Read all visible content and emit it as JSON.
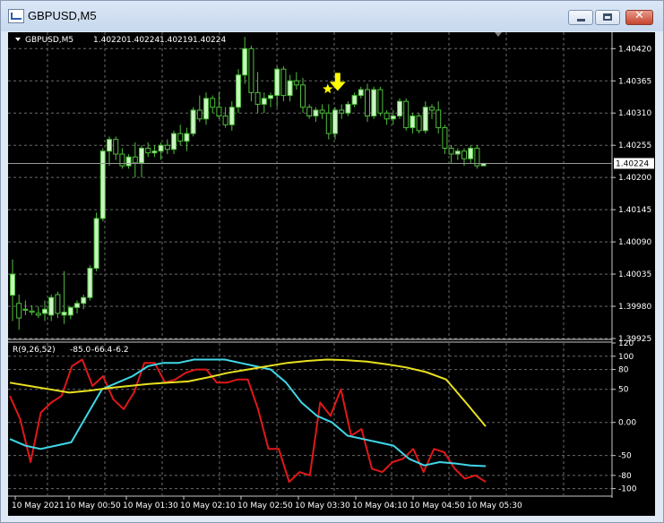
{
  "window": {
    "title": "GBPUSD,M5",
    "close_glyph": "✕",
    "icons": {
      "app": "chart-window-icon",
      "minimize": "minimize-icon",
      "maximize": "maximize-icon",
      "close": "close-icon",
      "triangle": "collapse-triangle-icon",
      "arrow": "down-arrow-icon",
      "star": "star-icon",
      "scroll_marker": "chart-shift-marker-icon"
    }
  },
  "colors": {
    "background": "#000000",
    "grid": "#6b6b6b",
    "text": "#ffffff",
    "bull_candle": "#c8f5c0",
    "bear_candle": "#000000",
    "wick": "#4fbf3c",
    "cyan_line": "#3fd7e8",
    "red_line": "#e01818",
    "yellow_line": "#e8e020",
    "marker": "#ffff00"
  },
  "price_header": {
    "symbol": "GBPUSD,M5",
    "open": "1.40220",
    "high": "1.40224",
    "low": "1.40219",
    "close": "1.40224"
  },
  "indicator_header": {
    "label": "R(9,26,52)",
    "v1": "-85.0",
    "v2": "-66.4",
    "v3": "-6.2"
  },
  "current_price": "1.40224",
  "price_axis": [
    "1.40420",
    "1.40365",
    "1.40310",
    "1.40255",
    "1.40200",
    "1.40145",
    "1.40090",
    "1.40035",
    "1.39980",
    "1.39925"
  ],
  "indicator_axis": [
    "120",
    "100",
    "80",
    "50",
    "0.00",
    "-50",
    "-80",
    "-100"
  ],
  "time_axis": [
    "10 May 2021",
    "10 May 00:50",
    "10 May 01:30",
    "10 May 02:10",
    "10 May 02:50",
    "10 May 03:30",
    "10 May 04:10",
    "10 May 04:50",
    "10 May 05:30"
  ],
  "chart_data": {
    "type": "candlestick",
    "symbol": "GBPUSD",
    "timeframe": "M5",
    "price_range": [
      1.39925,
      1.40448
    ],
    "candles": [
      {
        "o": 1.39999,
        "h": 1.4006,
        "l": 1.39955,
        "c": 1.40035
      },
      {
        "o": 1.39985,
        "h": 1.4,
        "l": 1.3994,
        "c": 1.3996
      },
      {
        "o": 1.39975,
        "h": 1.3999,
        "l": 1.39965,
        "c": 1.39975
      },
      {
        "o": 1.39972,
        "h": 1.39982,
        "l": 1.39965,
        "c": 1.3997
      },
      {
        "o": 1.39968,
        "h": 1.3998,
        "l": 1.3996,
        "c": 1.39965
      },
      {
        "o": 1.39968,
        "h": 1.3999,
        "l": 1.39955,
        "c": 1.39975
      },
      {
        "o": 1.39965,
        "h": 1.4,
        "l": 1.39955,
        "c": 1.39995
      },
      {
        "o": 1.4,
        "h": 1.40005,
        "l": 1.3996,
        "c": 1.39968
      },
      {
        "o": 1.39965,
        "h": 1.4004,
        "l": 1.3995,
        "c": 1.3997
      },
      {
        "o": 1.39965,
        "h": 1.3998,
        "l": 1.39958,
        "c": 1.39978
      },
      {
        "o": 1.39978,
        "h": 1.3999,
        "l": 1.39968,
        "c": 1.39985
      },
      {
        "o": 1.39985,
        "h": 1.4,
        "l": 1.39975,
        "c": 1.39995
      },
      {
        "o": 1.39995,
        "h": 1.4005,
        "l": 1.3999,
        "c": 1.40045
      },
      {
        "o": 1.40045,
        "h": 1.4014,
        "l": 1.4004,
        "c": 1.4013
      },
      {
        "o": 1.4013,
        "h": 1.4025,
        "l": 1.40125,
        "c": 1.40245
      },
      {
        "o": 1.40245,
        "h": 1.4027,
        "l": 1.4022,
        "c": 1.40265
      },
      {
        "o": 1.40265,
        "h": 1.4027,
        "l": 1.4023,
        "c": 1.4024
      },
      {
        "o": 1.4024,
        "h": 1.4025,
        "l": 1.40215,
        "c": 1.4022
      },
      {
        "o": 1.4022,
        "h": 1.4024,
        "l": 1.40215,
        "c": 1.40235
      },
      {
        "o": 1.40235,
        "h": 1.4026,
        "l": 1.402,
        "c": 1.40225
      },
      {
        "o": 1.40225,
        "h": 1.40255,
        "l": 1.402,
        "c": 1.4025
      },
      {
        "o": 1.4025,
        "h": 1.4026,
        "l": 1.40235,
        "c": 1.40242
      },
      {
        "o": 1.40242,
        "h": 1.40255,
        "l": 1.40235,
        "c": 1.40245
      },
      {
        "o": 1.40245,
        "h": 1.4026,
        "l": 1.4023,
        "c": 1.40255
      },
      {
        "o": 1.40255,
        "h": 1.40265,
        "l": 1.4024,
        "c": 1.40248
      },
      {
        "o": 1.40248,
        "h": 1.4028,
        "l": 1.4024,
        "c": 1.40275
      },
      {
        "o": 1.40275,
        "h": 1.4029,
        "l": 1.40255,
        "c": 1.40262
      },
      {
        "o": 1.40262,
        "h": 1.40285,
        "l": 1.40245,
        "c": 1.40275
      },
      {
        "o": 1.40275,
        "h": 1.4032,
        "l": 1.4027,
        "c": 1.40315
      },
      {
        "o": 1.40315,
        "h": 1.4034,
        "l": 1.40295,
        "c": 1.403
      },
      {
        "o": 1.403,
        "h": 1.40345,
        "l": 1.4029,
        "c": 1.40335
      },
      {
        "o": 1.40335,
        "h": 1.4034,
        "l": 1.4031,
        "c": 1.4032
      },
      {
        "o": 1.4032,
        "h": 1.40345,
        "l": 1.403,
        "c": 1.40305
      },
      {
        "o": 1.40305,
        "h": 1.4032,
        "l": 1.40285,
        "c": 1.4029
      },
      {
        "o": 1.4029,
        "h": 1.4033,
        "l": 1.4028,
        "c": 1.4032
      },
      {
        "o": 1.4032,
        "h": 1.40385,
        "l": 1.4031,
        "c": 1.40375
      },
      {
        "o": 1.40375,
        "h": 1.4044,
        "l": 1.4036,
        "c": 1.4042
      },
      {
        "o": 1.4042,
        "h": 1.40425,
        "l": 1.4033,
        "c": 1.40345
      },
      {
        "o": 1.40345,
        "h": 1.4038,
        "l": 1.4031,
        "c": 1.40325
      },
      {
        "o": 1.40325,
        "h": 1.40345,
        "l": 1.4031,
        "c": 1.40335
      },
      {
        "o": 1.40335,
        "h": 1.40345,
        "l": 1.4032,
        "c": 1.4034
      },
      {
        "o": 1.4034,
        "h": 1.4039,
        "l": 1.4032,
        "c": 1.40385
      },
      {
        "o": 1.40385,
        "h": 1.4039,
        "l": 1.4033,
        "c": 1.4034
      },
      {
        "o": 1.4034,
        "h": 1.40375,
        "l": 1.4033,
        "c": 1.40365
      },
      {
        "o": 1.40365,
        "h": 1.4038,
        "l": 1.4035,
        "c": 1.40358
      },
      {
        "o": 1.40358,
        "h": 1.4037,
        "l": 1.4031,
        "c": 1.4032
      },
      {
        "o": 1.4032,
        "h": 1.40325,
        "l": 1.403,
        "c": 1.40305
      },
      {
        "o": 1.40305,
        "h": 1.4032,
        "l": 1.40295,
        "c": 1.40315
      },
      {
        "o": 1.40315,
        "h": 1.40325,
        "l": 1.403,
        "c": 1.4031
      },
      {
        "o": 1.4031,
        "h": 1.40325,
        "l": 1.40265,
        "c": 1.40275
      },
      {
        "o": 1.40275,
        "h": 1.4032,
        "l": 1.40265,
        "c": 1.40315
      },
      {
        "o": 1.40315,
        "h": 1.40325,
        "l": 1.403,
        "c": 1.4031
      },
      {
        "o": 1.4031,
        "h": 1.4033,
        "l": 1.40305,
        "c": 1.40325
      },
      {
        "o": 1.40325,
        "h": 1.40345,
        "l": 1.4032,
        "c": 1.4034
      },
      {
        "o": 1.4034,
        "h": 1.40355,
        "l": 1.40335,
        "c": 1.4035
      },
      {
        "o": 1.4035,
        "h": 1.4036,
        "l": 1.40295,
        "c": 1.40305
      },
      {
        "o": 1.40305,
        "h": 1.40355,
        "l": 1.403,
        "c": 1.4035
      },
      {
        "o": 1.4035,
        "h": 1.40355,
        "l": 1.40305,
        "c": 1.4031
      },
      {
        "o": 1.4031,
        "h": 1.40315,
        "l": 1.4029,
        "c": 1.403
      },
      {
        "o": 1.403,
        "h": 1.40315,
        "l": 1.4029,
        "c": 1.40305
      },
      {
        "o": 1.40305,
        "h": 1.40335,
        "l": 1.403,
        "c": 1.4033
      },
      {
        "o": 1.4033,
        "h": 1.40335,
        "l": 1.4028,
        "c": 1.40285
      },
      {
        "o": 1.40285,
        "h": 1.4031,
        "l": 1.40275,
        "c": 1.40305
      },
      {
        "o": 1.40305,
        "h": 1.4031,
        "l": 1.40275,
        "c": 1.4028
      },
      {
        "o": 1.4028,
        "h": 1.4033,
        "l": 1.40275,
        "c": 1.4032
      },
      {
        "o": 1.4032,
        "h": 1.40325,
        "l": 1.403,
        "c": 1.40315
      },
      {
        "o": 1.40315,
        "h": 1.4033,
        "l": 1.40275,
        "c": 1.40285
      },
      {
        "o": 1.40285,
        "h": 1.4029,
        "l": 1.4024,
        "c": 1.4025
      },
      {
        "o": 1.4025,
        "h": 1.40255,
        "l": 1.40225,
        "c": 1.4024
      },
      {
        "o": 1.4024,
        "h": 1.4025,
        "l": 1.4023,
        "c": 1.40245
      },
      {
        "o": 1.40245,
        "h": 1.4025,
        "l": 1.4022,
        "c": 1.40232
      },
      {
        "o": 1.40232,
        "h": 1.40255,
        "l": 1.40225,
        "c": 1.4025
      },
      {
        "o": 1.4025,
        "h": 1.40255,
        "l": 1.40215,
        "c": 1.4022
      },
      {
        "o": 1.4022,
        "h": 1.40225,
        "l": 1.40219,
        "c": 1.40224
      }
    ],
    "marker": {
      "type": "arrow+star",
      "candle_index": 49
    },
    "indicator": {
      "name": "R(9,26,52)",
      "range": [
        -110,
        120
      ],
      "series": [
        {
          "name": "9",
          "color": "#e01818",
          "values": [
            40,
            5,
            -60,
            15,
            30,
            40,
            85,
            95,
            55,
            70,
            35,
            20,
            45,
            90,
            90,
            60,
            65,
            75,
            80,
            80,
            60,
            60,
            65,
            65,
            20,
            -40,
            -40,
            -90,
            -75,
            -80,
            30,
            10,
            50,
            -20,
            -10,
            -70,
            -75,
            -60,
            -55,
            -40,
            -75,
            -40,
            -45,
            -70,
            -85,
            -80,
            -90
          ]
        },
        {
          "name": "26",
          "color": "#3fd7e8",
          "values": [
            -25,
            -35,
            -40,
            -35,
            -30,
            10,
            50,
            60,
            70,
            85,
            90,
            90,
            95,
            95,
            95,
            90,
            85,
            80,
            60,
            30,
            10,
            0,
            -20,
            -25,
            -30,
            -35,
            -55,
            -65,
            -60,
            -62,
            -65,
            -66
          ]
        },
        {
          "name": "52",
          "color": "#e8e020",
          "values": [
            60,
            55,
            50,
            45,
            48,
            52,
            55,
            58,
            60,
            62,
            68,
            75,
            80,
            85,
            90,
            93,
            95,
            94,
            92,
            88,
            83,
            76,
            65,
            30,
            -6
          ]
        }
      ]
    }
  }
}
